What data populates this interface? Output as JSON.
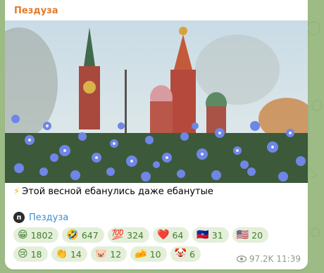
{
  "message": {
    "sender": "Пездуза",
    "caption_icon": "⚡",
    "caption": "Этой весной ебанулись даже ебанутые",
    "channel_name": "Пездуза",
    "channel_avatar_letter": "п",
    "views": "97.2K",
    "time": "11:39"
  },
  "reactions": [
    {
      "icon": "grinning-face",
      "emoji": "😁",
      "count": "1802"
    },
    {
      "icon": "rofl-face",
      "emoji": "🤣",
      "count": "647"
    },
    {
      "icon": "hundred",
      "emoji": "💯",
      "count": "324"
    },
    {
      "icon": "red-heart",
      "emoji": "❤️",
      "count": "64"
    },
    {
      "icon": "flag-haiti",
      "emoji": "🇭🇹",
      "count": "31"
    },
    {
      "icon": "flag-usa",
      "emoji": "🇺🇸",
      "count": "20"
    },
    {
      "icon": "crying-face",
      "emoji": "😢",
      "count": "18"
    },
    {
      "icon": "clapping-hands",
      "emoji": "👏",
      "count": "14"
    },
    {
      "icon": "pig-face",
      "emoji": "🐷",
      "count": "12"
    },
    {
      "icon": "cheese-wedge",
      "emoji": "🧀",
      "count": "10"
    },
    {
      "icon": "clown-face",
      "emoji": "🤡",
      "count": "6"
    }
  ],
  "colors": {
    "sender": "#e07b2c",
    "reaction_bg": "#e4efd9",
    "reaction_text": "#3f7f2e",
    "link": "#3a8fd1"
  }
}
